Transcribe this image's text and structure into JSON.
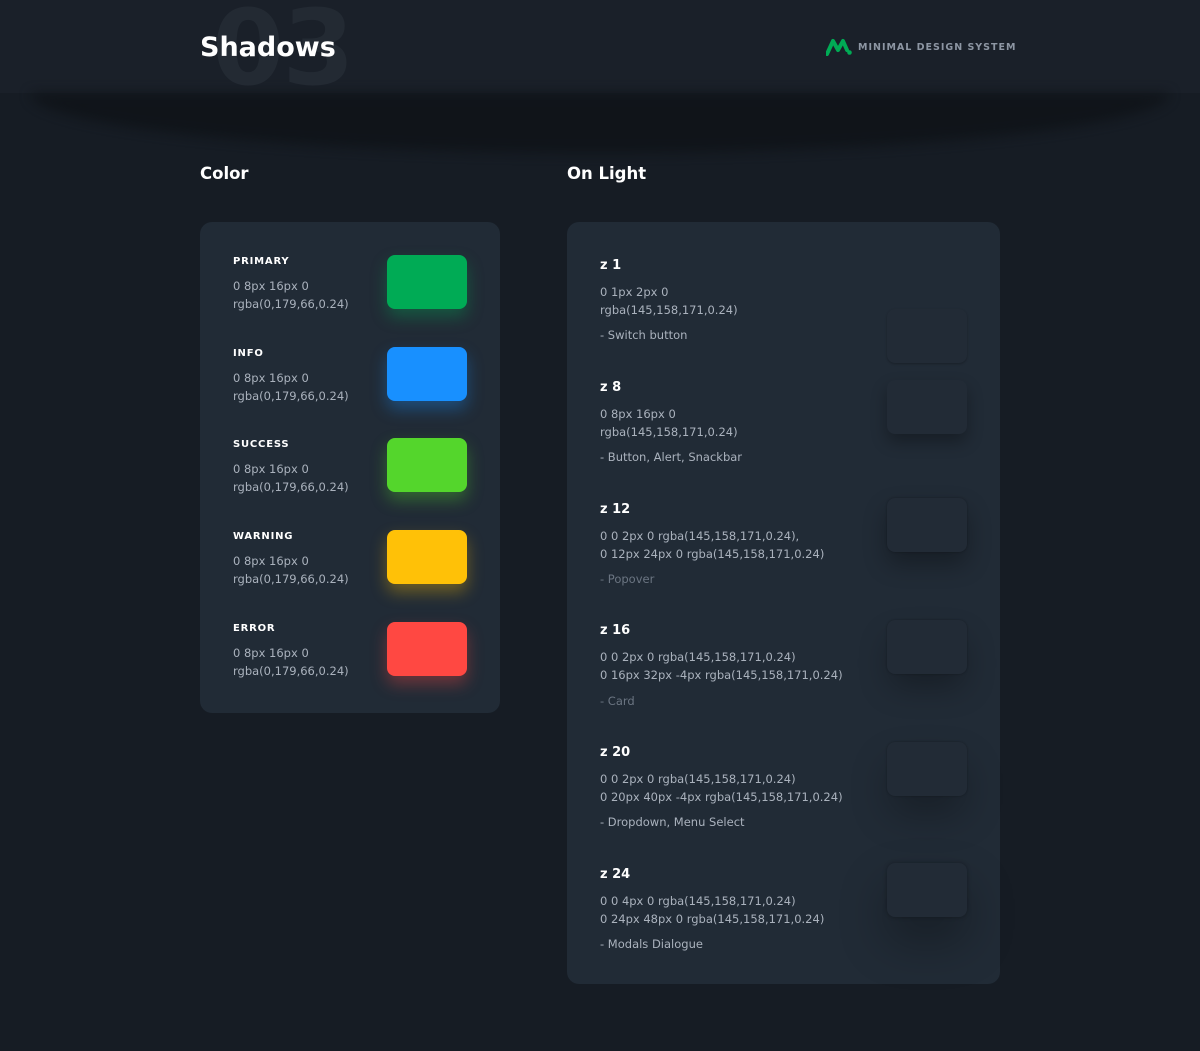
{
  "header": {
    "section_number": "03",
    "title": "Shadows",
    "brand_text": "MINIMAL DESIGN SYSTEM",
    "brand_color": "#00ab55",
    "logo_icon": "minimal-logo-icon"
  },
  "sections": {
    "color_title": "Color",
    "light_title": "On Light"
  },
  "colors": [
    {
      "name": "PRIMARY",
      "spec": "0 8px 16px 0\nrgba(0,179,66,0.24)",
      "swatch": "#00ab55",
      "glow": "rgba(0,171,85,0.35)"
    },
    {
      "name": "INFO",
      "spec": "0 8px 16px 0\nrgba(0,179,66,0.24)",
      "swatch": "#1890ff",
      "glow": "rgba(24,144,255,0.35)"
    },
    {
      "name": "SUCCESS",
      "spec": "0 8px 16px 0\nrgba(0,179,66,0.24)",
      "swatch": "#54d62c",
      "glow": "rgba(84,214,44,0.35)"
    },
    {
      "name": "WARNING",
      "spec": "0 8px 16px 0\nrgba(0,179,66,0.24)",
      "swatch": "#ffc107",
      "glow": "rgba(255,193,7,0.35)"
    },
    {
      "name": "ERROR",
      "spec": "0 8px 16px 0\nrgba(0,179,66,0.24)",
      "swatch": "#ff4842",
      "glow": "rgba(255,72,66,0.35)"
    }
  ],
  "elevations": [
    {
      "title": "z 1",
      "spec": "0 1px 2px 0\nrgba(145,158,171,0.24)",
      "use": "- Switch button",
      "muted": false
    },
    {
      "title": "z 8",
      "spec": "0 8px 16px 0\nrgba(145,158,171,0.24)",
      "use": "- Button, Alert, Snackbar",
      "muted": false
    },
    {
      "title": "z 12",
      "spec": "0 0 2px 0 rgba(145,158,171,0.24),\n0 12px 24px 0 rgba(145,158,171,0.24)",
      "use": "- Popover",
      "muted": true
    },
    {
      "title": "z 16",
      "spec": "0 0 2px 0 rgba(145,158,171,0.24)\n0 16px 32px -4px rgba(145,158,171,0.24)",
      "use": "- Card",
      "muted": true
    },
    {
      "title": "z 20",
      "spec": "0 0 2px 0 rgba(145,158,171,0.24)\n0 20px 40px -4px rgba(145,158,171,0.24)",
      "use": "- Dropdown, Menu Select",
      "muted": false
    },
    {
      "title": "z 24",
      "spec": "0 0 4px 0 rgba(145,158,171,0.24)\n0 24px 48px 0 rgba(145,158,171,0.24)",
      "use": "- Modals Dialogue",
      "muted": false
    }
  ]
}
